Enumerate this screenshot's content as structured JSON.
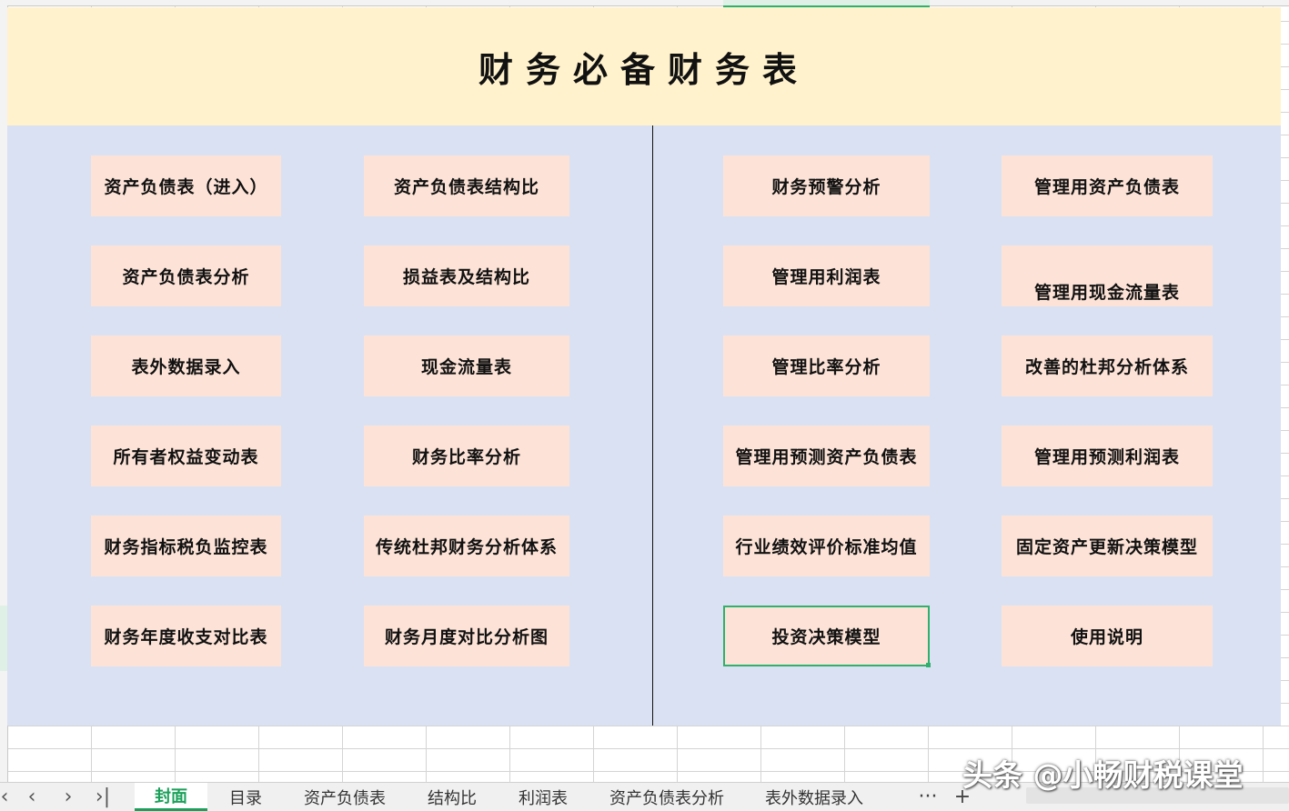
{
  "sheet": {
    "title": "财务必备财务表",
    "left_buttons": [
      [
        "资产负债表（进入）",
        "资产负债表结构比"
      ],
      [
        "资产负债表分析",
        "损益表及结构比"
      ],
      [
        "表外数据录入",
        "现金流量表"
      ],
      [
        "所有者权益变动表",
        "财务比率分析"
      ],
      [
        "财务指标税负监控表",
        "传统杜邦财务分析体系"
      ],
      [
        "财务年度收支对比表",
        "财务月度对比分析图"
      ]
    ],
    "right_buttons": [
      [
        "财务预警分析",
        "管理用资产负债表"
      ],
      [
        "管理用利润表",
        "管理用现金流量表"
      ],
      [
        "管理比率分析",
        "改善的杜邦分析体系"
      ],
      [
        "管理用预测资产负债表",
        "管理用预测利润表"
      ],
      [
        "行业绩效评价标准均值",
        "固定资产更新决策模型"
      ],
      [
        "投资决策模型",
        "使用说明"
      ]
    ]
  },
  "tabs": {
    "nav": [
      "‹",
      "‹",
      "›",
      "›|"
    ],
    "items": [
      "封面",
      "目录",
      "资产负债表",
      "结构比",
      "利润表",
      "资产负债表分析",
      "表外数据录入"
    ],
    "more": "···",
    "add": "+"
  },
  "watermark": "头条 @小畅财税课堂",
  "colors": {
    "title_band": "#fff2cc",
    "body_band": "#dae1f2",
    "button": "#fde3d7",
    "accent": "#1aa05a"
  }
}
